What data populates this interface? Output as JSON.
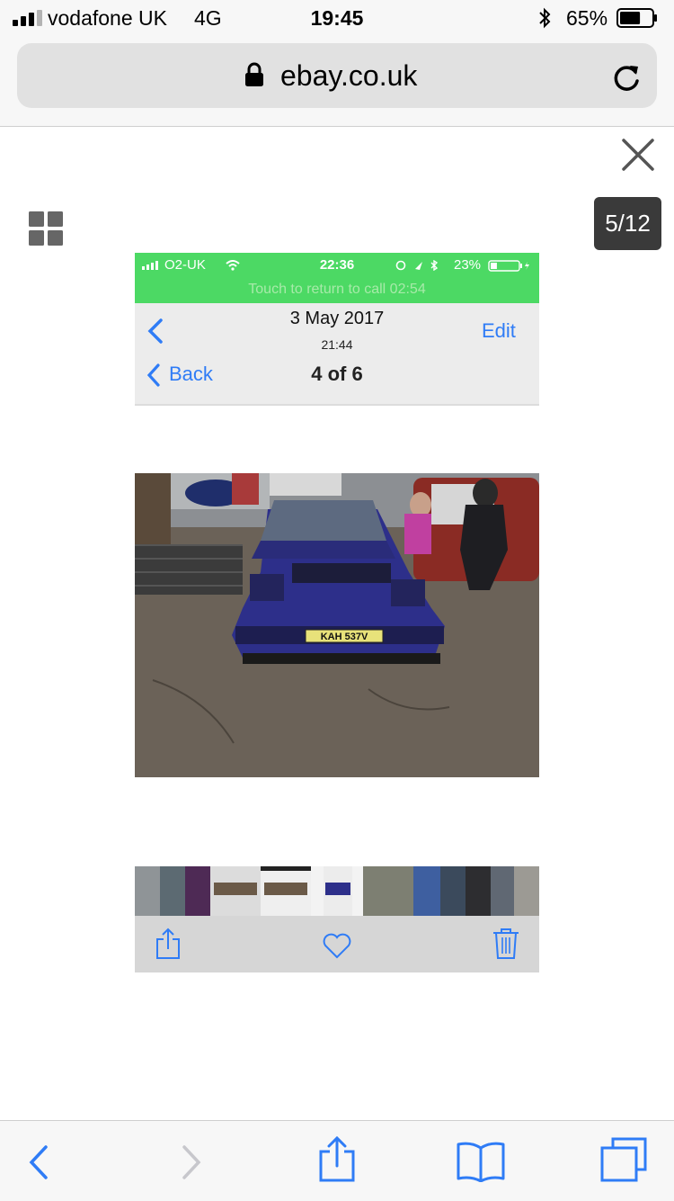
{
  "status_bar": {
    "carrier": "vodafone UK",
    "network": "4G",
    "time": "19:45",
    "battery_percent": "65%",
    "battery_level": 0.65
  },
  "address_bar": {
    "url": "ebay.co.uk",
    "icons": [
      "lock-icon",
      "reload-icon"
    ]
  },
  "viewer": {
    "counter": "5/12",
    "icons": [
      "close-icon",
      "grid-icon"
    ]
  },
  "photo": {
    "status": {
      "carrier": "O2-UK",
      "time": "22:36",
      "battery_percent": "23%",
      "battery_level": 0.23,
      "call_banner": "Touch to return to call 02:54"
    },
    "nav": {
      "date": "3 May 2017",
      "time": "21:44",
      "edit": "Edit",
      "back": "Back",
      "position": "4 of 6"
    },
    "plate": "KAH 537V",
    "toolbar_icons": [
      "share-icon",
      "heart-icon",
      "trash-icon"
    ]
  },
  "bottom_toolbar": {
    "icons": [
      "back-arrow-icon",
      "forward-arrow-icon",
      "share-icon",
      "bookmarks-icon",
      "tabs-icon"
    ]
  },
  "colors": {
    "call_green": "#4cd964",
    "ios_blue": "#2f7cf6",
    "car_blue": "#2d2f8a",
    "badge_dark": "#3a3a3a"
  }
}
